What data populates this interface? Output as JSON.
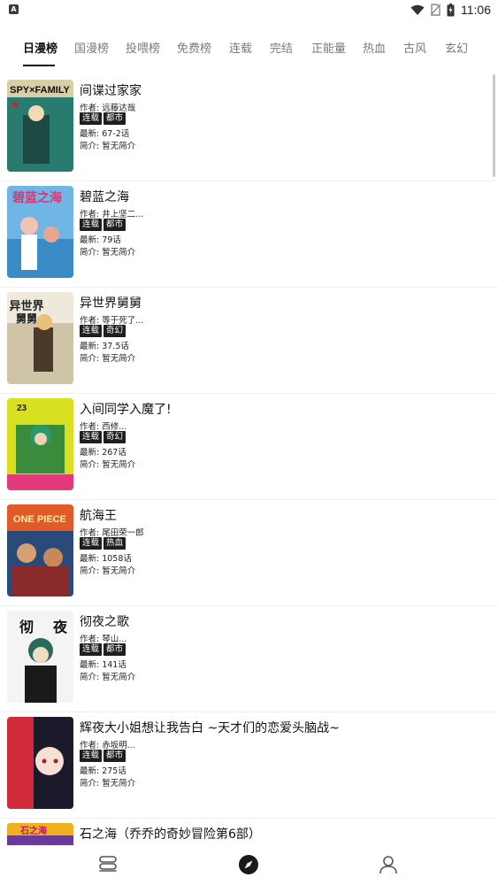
{
  "status_bar": {
    "left_badge": "A",
    "time": "11:06",
    "icons": [
      "wifi-icon",
      "no-sim-icon",
      "battery-charging-icon"
    ]
  },
  "tabs": [
    {
      "label": "日漫榜",
      "active": true
    },
    {
      "label": "国漫榜",
      "active": false
    },
    {
      "label": "投喂榜",
      "active": false
    },
    {
      "label": "免费榜",
      "active": false
    },
    {
      "label": "连载",
      "active": false
    },
    {
      "label": "完结",
      "active": false
    },
    {
      "label": "正能量",
      "active": false
    },
    {
      "label": "热血",
      "active": false
    },
    {
      "label": "古风",
      "active": false
    },
    {
      "label": "玄幻",
      "active": false
    }
  ],
  "comics": [
    {
      "title": "间谍过家家",
      "author": "作者: 远藤达哉",
      "tags": [
        "连载",
        "都市"
      ],
      "latest": "最新: 67-2话",
      "desc": "简介: 暂无简介",
      "cover_text": "SPY×FAMILY",
      "cover_colors": [
        "#2a7b6f",
        "#d8cfa8"
      ]
    },
    {
      "title": "碧蓝之海",
      "author": "作者: 井上坚二...",
      "tags": [
        "连载",
        "都市"
      ],
      "latest": "最新: 79话",
      "desc": "简介: 暂无简介",
      "cover_text": "碧蓝之海",
      "cover_colors": [
        "#6fb6e6",
        "#f3c2b2"
      ]
    },
    {
      "title": "异世界舅舅",
      "author": "作者: 等于死了...",
      "tags": [
        "连载",
        "奇幻"
      ],
      "latest": "最新: 37.5话",
      "desc": "简介: 暂无简介",
      "cover_text": "异世界舅舅",
      "cover_colors": [
        "#d6c6a4",
        "#4a3a2a"
      ]
    },
    {
      "title": "入间同学入魔了!",
      "author": "作者: 西修...",
      "tags": [
        "连载",
        "奇幻"
      ],
      "latest": "最新: 267话",
      "desc": "简介: 暂无简介",
      "cover_text": "23",
      "cover_colors": [
        "#d9e020",
        "#3a8b3c"
      ]
    },
    {
      "title": "航海王",
      "author": "作者: 尾田荣一郎",
      "tags": [
        "连载",
        "热血"
      ],
      "latest": "最新: 1058话",
      "desc": "简介: 暂无简介",
      "cover_text": "ONE PIECE",
      "cover_colors": [
        "#e05a2a",
        "#2a4a7a"
      ]
    },
    {
      "title": "彻夜之歌",
      "author": "作者: 琴山...",
      "tags": [
        "连载",
        "都市"
      ],
      "latest": "最新: 141话",
      "desc": "简介: 暂无简介",
      "cover_text": "彻夜",
      "cover_colors": [
        "#f2f2f2",
        "#2a6a5a"
      ]
    },
    {
      "title": "辉夜大小姐想让我告白 ~天才们的恋爱头脑战~",
      "author": "作者: 赤坂明...",
      "tags": [
        "连载",
        "都市"
      ],
      "latest": "最新: 275话",
      "desc": "简介: 暂无简介",
      "cover_text": "",
      "cover_colors": [
        "#d22a3a",
        "#1a1a2a"
      ]
    },
    {
      "title": "石之海（乔乔的奇妙冒险第6部）",
      "author": "",
      "tags": [],
      "latest": "",
      "desc": "",
      "cover_text": "石之海",
      "cover_colors": [
        "#f0b020",
        "#6a3a9a"
      ]
    }
  ],
  "bottom_nav": [
    {
      "icon": "bookshelf-icon",
      "active": false
    },
    {
      "icon": "discover-compass-icon",
      "active": true
    },
    {
      "icon": "profile-icon",
      "active": false
    }
  ]
}
